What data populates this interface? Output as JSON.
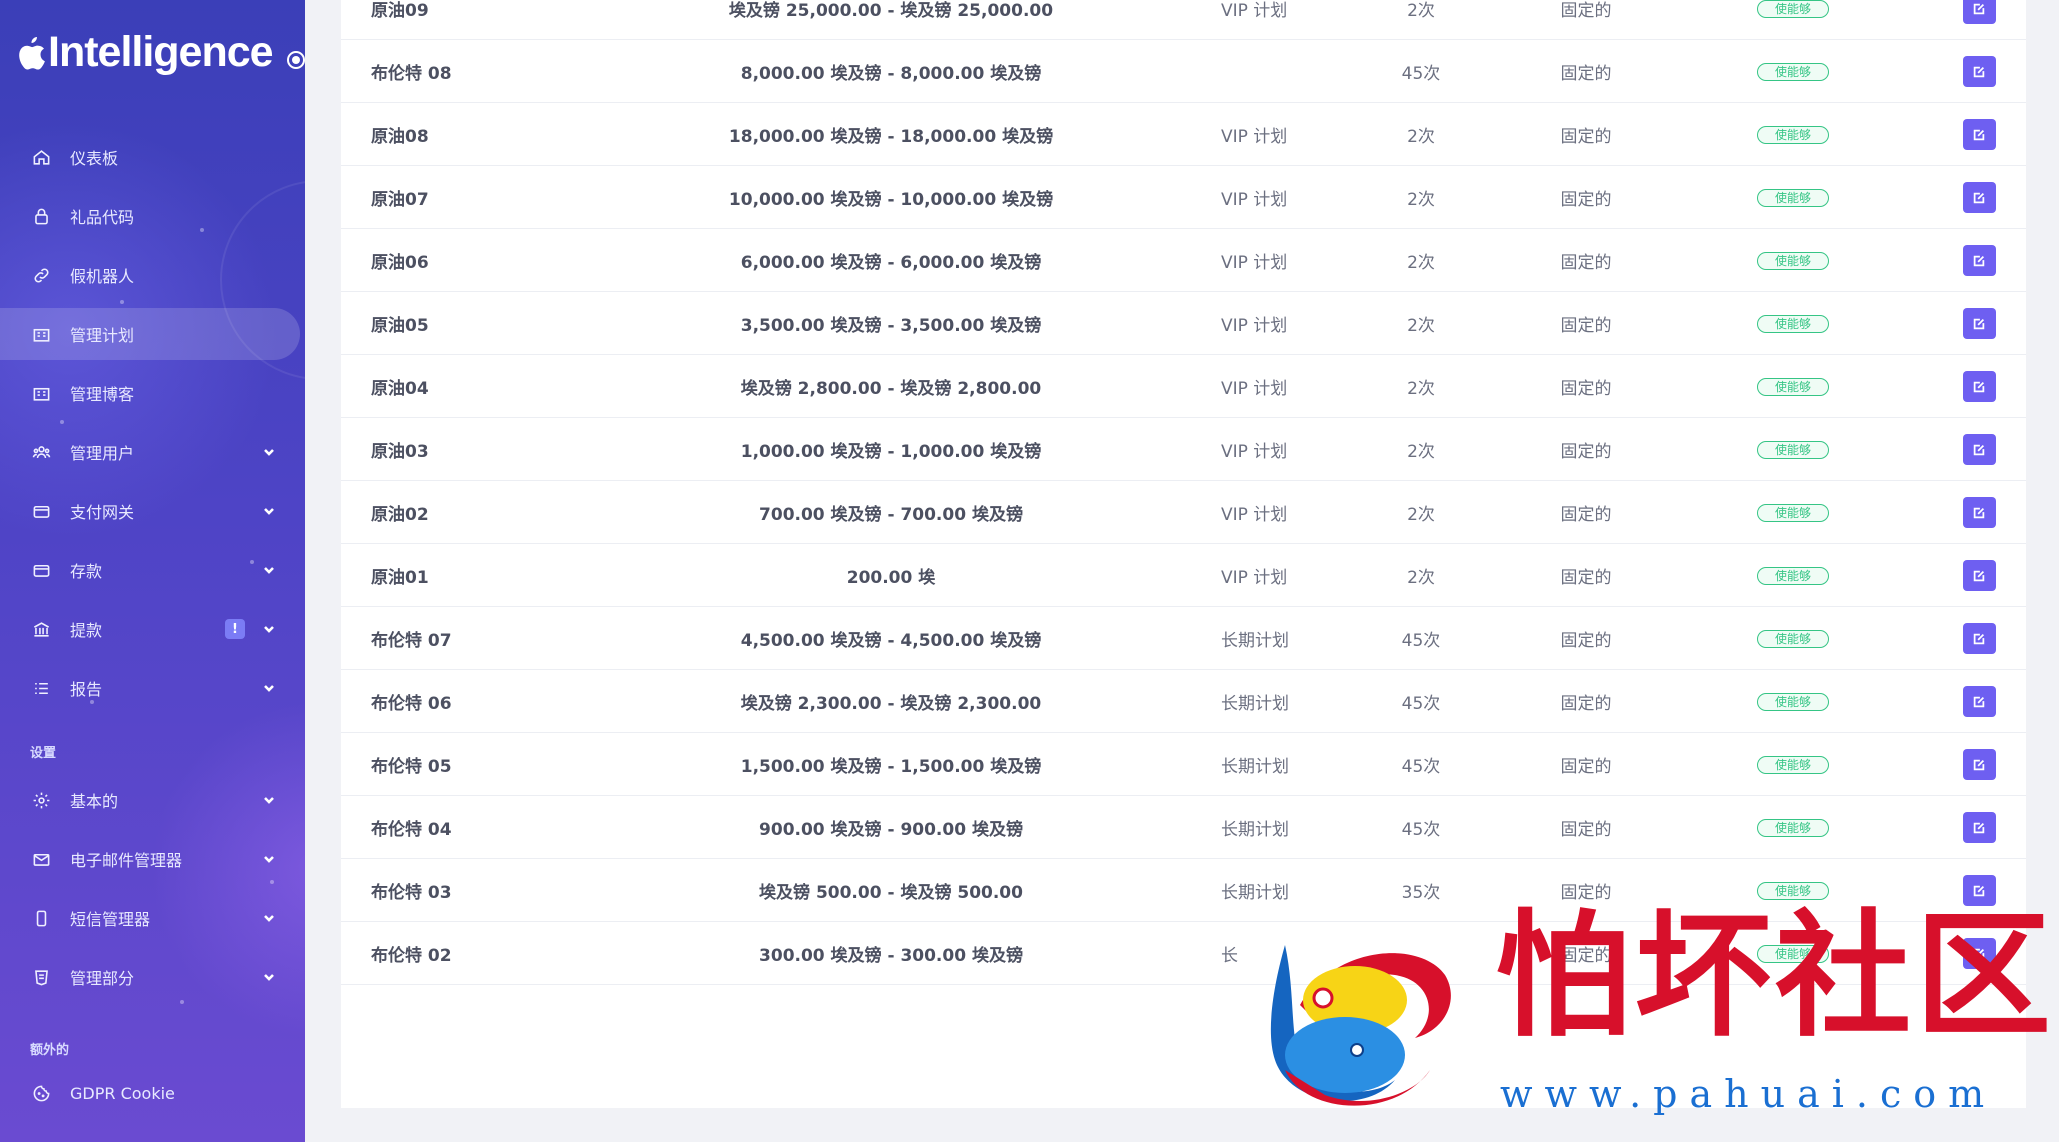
{
  "sidebar": {
    "brand": "Intelligence",
    "items": [
      {
        "label": "仪表板",
        "icon": "home-icon"
      },
      {
        "label": "礼品代码",
        "icon": "lock-icon"
      },
      {
        "label": "假机器人",
        "icon": "link-icon"
      },
      {
        "label": "管理计划",
        "icon": "building-icon",
        "active": true
      },
      {
        "label": "管理博客",
        "icon": "building-icon"
      },
      {
        "label": "管理用户",
        "icon": "users-icon"
      },
      {
        "label": "支付网关",
        "icon": "card-icon"
      },
      {
        "label": "存款",
        "icon": "card-icon"
      },
      {
        "label": "提款",
        "icon": "bank-icon",
        "badge": "!"
      },
      {
        "label": "报告",
        "icon": "list-icon"
      }
    ],
    "settings_label": "设置",
    "settings_items": [
      {
        "label": "基本的",
        "icon": "gear-icon"
      },
      {
        "label": "电子邮件管理器",
        "icon": "mail-icon"
      },
      {
        "label": "短信管理器",
        "icon": "phone-icon"
      },
      {
        "label": "管理部分",
        "icon": "shield-icon"
      }
    ],
    "extra_label": "额外的",
    "extra_items": [
      {
        "label": "GDPR Cookie",
        "icon": "cookie-icon"
      }
    ]
  },
  "table": {
    "rows": [
      {
        "name": "原油09",
        "range": "埃及镑 25,000.00 - 埃及镑 25,000.00",
        "plan": "VIP 计划",
        "times": "2次",
        "type": "固定的",
        "status": "使能够"
      },
      {
        "name": "布伦特 08",
        "range": "8,000.00 埃及镑 - 8,000.00 埃及镑",
        "plan": "",
        "times": "45次",
        "type": "固定的",
        "status": "使能够"
      },
      {
        "name": "原油08",
        "range": "18,000.00 埃及镑 - 18,000.00 埃及镑",
        "plan": "VIP 计划",
        "times": "2次",
        "type": "固定的",
        "status": "使能够"
      },
      {
        "name": "原油07",
        "range": "10,000.00 埃及镑 - 10,000.00 埃及镑",
        "plan": "VIP 计划",
        "times": "2次",
        "type": "固定的",
        "status": "使能够"
      },
      {
        "name": "原油06",
        "range": "6,000.00 埃及镑 - 6,000.00 埃及镑",
        "plan": "VIP 计划",
        "times": "2次",
        "type": "固定的",
        "status": "使能够"
      },
      {
        "name": "原油05",
        "range": "3,500.00 埃及镑 - 3,500.00 埃及镑",
        "plan": "VIP 计划",
        "times": "2次",
        "type": "固定的",
        "status": "使能够"
      },
      {
        "name": "原油04",
        "range": "埃及镑 2,800.00 - 埃及镑 2,800.00",
        "plan": "VIP 计划",
        "times": "2次",
        "type": "固定的",
        "status": "使能够"
      },
      {
        "name": "原油03",
        "range": "1,000.00 埃及镑 - 1,000.00 埃及镑",
        "plan": "VIP 计划",
        "times": "2次",
        "type": "固定的",
        "status": "使能够"
      },
      {
        "name": "原油02",
        "range": "700.00 埃及镑 - 700.00 埃及镑",
        "plan": "VIP 计划",
        "times": "2次",
        "type": "固定的",
        "status": "使能够"
      },
      {
        "name": "原油01",
        "range": "200.00 埃",
        "plan": "VIP 计划",
        "times": "2次",
        "type": "固定的",
        "status": "使能够"
      },
      {
        "name": "布伦特 07",
        "range": "4,500.00 埃及镑 - 4,500.00 埃及镑",
        "plan": "长期计划",
        "times": "45次",
        "type": "固定的",
        "status": "使能够"
      },
      {
        "name": "布伦特 06",
        "range": "埃及镑 2,300.00 - 埃及镑 2,300.00",
        "plan": "长期计划",
        "times": "45次",
        "type": "固定的",
        "status": "使能够"
      },
      {
        "name": "布伦特 05",
        "range": "1,500.00 埃及镑 - 1,500.00 埃及镑",
        "plan": "长期计划",
        "times": "45次",
        "type": "固定的",
        "status": "使能够"
      },
      {
        "name": "布伦特 04",
        "range": "900.00 埃及镑 - 900.00 埃及镑",
        "plan": "长期计划",
        "times": "45次",
        "type": "固定的",
        "status": "使能够"
      },
      {
        "name": "布伦特 03",
        "range": "埃及镑 500.00 - 埃及镑 500.00",
        "plan": "长期计划",
        "times": "35次",
        "type": "固定的",
        "status": "使能够"
      },
      {
        "name": "布伦特 02",
        "range": "300.00 埃及镑 - 300.00 埃及镑",
        "plan": "长",
        "times": "",
        "type": "固定的",
        "status": "使能够"
      }
    ]
  },
  "watermark": {
    "text": "怕坏社区",
    "url": "www.pahuai.com"
  },
  "colors": {
    "sidebar_top": "#3b3fb8",
    "sidebar_bottom": "#6a4bd1",
    "status_green": "#35c585",
    "edit_button": "#6e5ff1",
    "watermark_red": "#d7102b",
    "watermark_blue": "#1a6fd2"
  }
}
